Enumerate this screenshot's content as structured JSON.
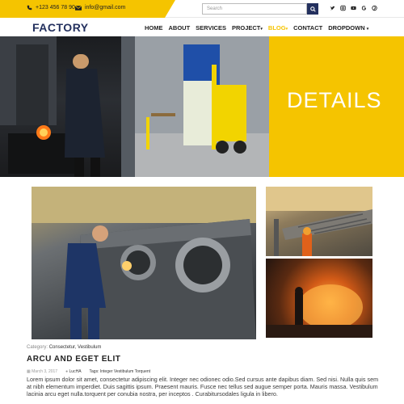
{
  "topbar": {
    "phone": "+123 456 78 90",
    "email": "info@gmail.com",
    "search_placeholder": "Search",
    "socials": [
      "twitter-icon",
      "instagram-icon",
      "youtube-icon",
      "google-icon",
      "pinterest-icon"
    ],
    "accent": "#f5c400"
  },
  "header": {
    "logo": "FACTORY",
    "nav": [
      {
        "label": "HOME"
      },
      {
        "label": "ABOUT"
      },
      {
        "label": "SERVICES"
      },
      {
        "label": "PROJECT",
        "dropdown": true
      },
      {
        "label": "BLOG",
        "dropdown": true,
        "active": true
      },
      {
        "label": "CONTACT"
      },
      {
        "label": "DROPDOWN",
        "dropdown": true
      }
    ],
    "brand_color": "#23305e"
  },
  "hero": {
    "title": "DETAILS",
    "panel_color": "#f5c400"
  },
  "post": {
    "category_label": "Category:",
    "categories": "Consectetur, Vestibulum",
    "title": "ARCU AND EGET ELIT",
    "date": "March 3, 2017",
    "author": "LucHA",
    "tags_label": "Tags:",
    "tags": "Integer Vestibulum Torquent",
    "body": "Lorem ipsum dolor sit amet, consectetur adipiscing elit. Integer nec odionec odio.Sed cursus ante dapibus diam. Sed nisi. Nulla quis sem at nibh elementum imperdiet. Duis sagittis ipsum. Praesent mauris. Fusce nec tellus sed augue semper porta. Mauris massa. Vestibulum lacinia arcu eget nulla.torquent per conubia nostra, per inceptos . Curabitursodales ligula in libero."
  }
}
